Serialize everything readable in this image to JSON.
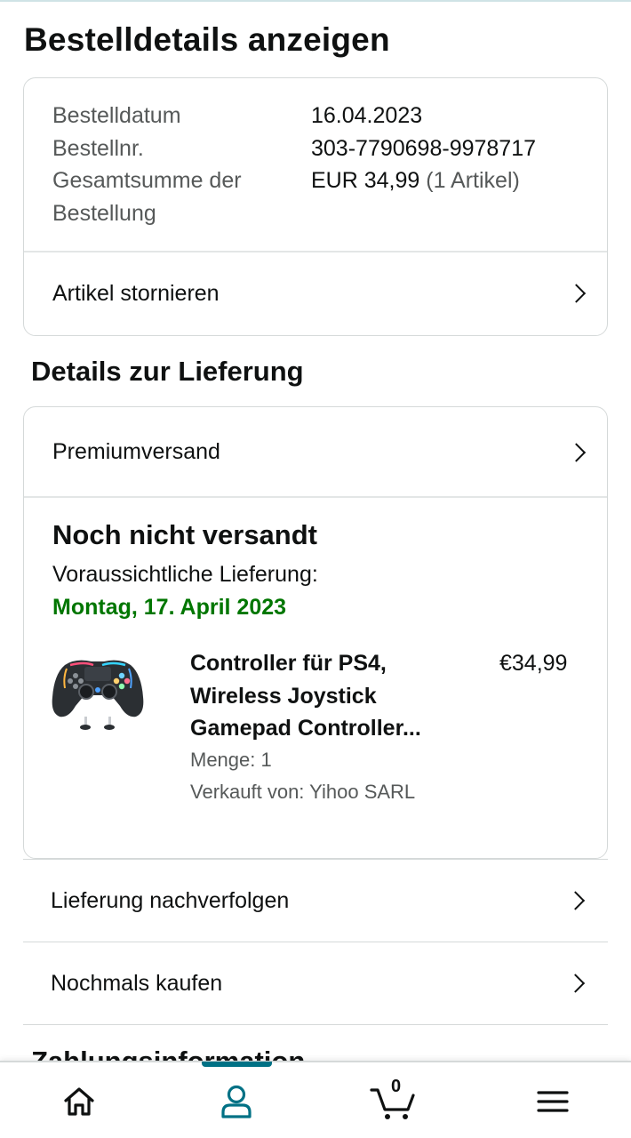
{
  "page": {
    "title": "Bestelldetails anzeigen"
  },
  "summary": {
    "rows": [
      {
        "label": "Bestelldatum",
        "value": "16.04.2023",
        "extra": ""
      },
      {
        "label": "Bestellnr.",
        "value": "303-7790698-9978717",
        "extra": ""
      },
      {
        "label": "Gesamtsumme der Bestellung",
        "value": "EUR 34,99",
        "extra": "(1 Artikel)"
      }
    ],
    "cancel_label": "Artikel stornieren"
  },
  "delivery": {
    "section_title": "Details zur Lieferung",
    "shipping_method": "Premiumversand",
    "status": "Noch nicht versandt",
    "expected_label": "Voraussichtliche Lieferung:",
    "expected_date": "Montag, 17. April 2023",
    "item": {
      "title": "Controller für PS4, Wireless Joystick Gamepad Controller...",
      "price": "€34,99",
      "quantity": "Menge: 1",
      "seller": "Verkauft von: Yihoo SARL"
    }
  },
  "actions": {
    "track": "Lieferung nachverfolgen",
    "buy_again": "Nochmals kaufen"
  },
  "next_section": {
    "title": "Zahlungsinformation"
  },
  "bottom_nav": {
    "items": [
      {
        "icon": "home-icon"
      },
      {
        "icon": "user-icon",
        "active": true
      },
      {
        "icon": "cart-icon",
        "count": "0"
      },
      {
        "icon": "menu-icon"
      }
    ]
  },
  "colors": {
    "accent": "#007185",
    "delivery_green": "#007600",
    "muted_text": "#565959"
  }
}
